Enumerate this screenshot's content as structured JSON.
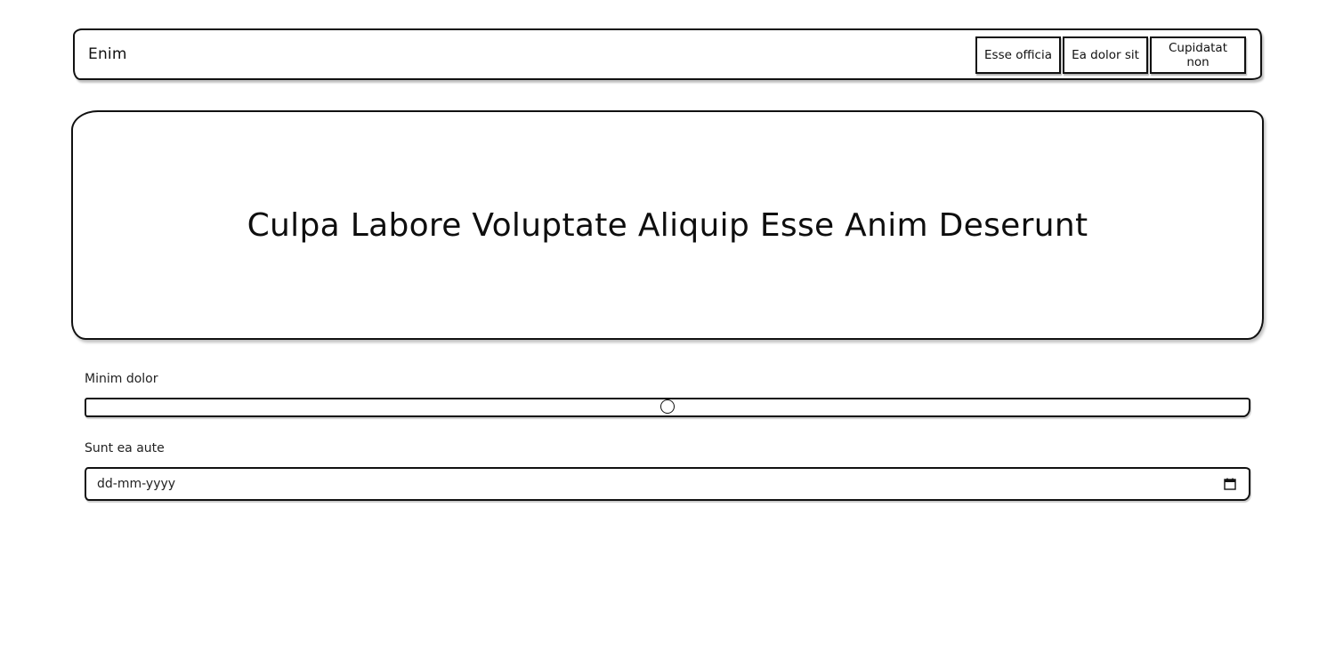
{
  "navbar": {
    "brand": "Enim",
    "buttons": [
      {
        "label": "Esse officia"
      },
      {
        "label": "Ea dolor sit"
      },
      {
        "label": "Cupidatat non"
      }
    ]
  },
  "hero": {
    "title": "Culpa Labore Voluptate Aliquip Esse Anim Deserunt"
  },
  "form": {
    "slider": {
      "label": "Minim dolor",
      "value_fraction": 0.5
    },
    "date": {
      "label": "Sunt ea aute",
      "placeholder": "dd-mm-yyyy",
      "icon": "calendar-icon"
    }
  }
}
